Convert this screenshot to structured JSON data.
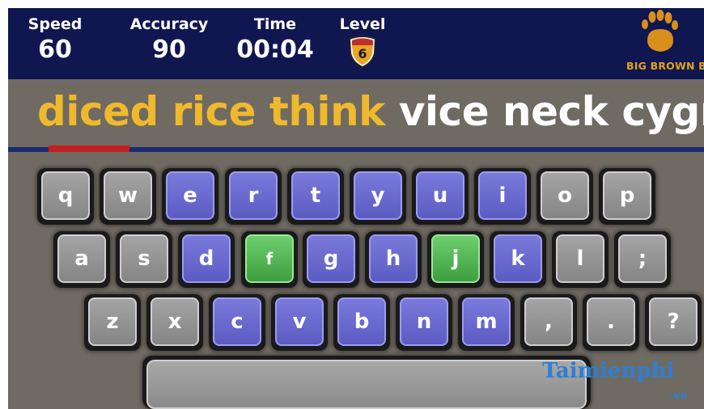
{
  "hud": {
    "speed": {
      "label": "Speed",
      "value": "60"
    },
    "accuracy": {
      "label": "Accuracy",
      "value": "90"
    },
    "time": {
      "label": "Time",
      "value": "00:04"
    },
    "level": {
      "label": "Level",
      "value": "6"
    },
    "logo_text": "BIG BROWN BEA"
  },
  "words": {
    "typed": "diced rice think",
    "pending": " vice neck cygnet"
  },
  "keyboard": {
    "row1": [
      "q",
      "w",
      "e",
      "r",
      "t",
      "y",
      "u",
      "i",
      "o",
      "p"
    ],
    "row2": [
      "a",
      "s",
      "d",
      "f",
      "g",
      "h",
      "j",
      "k",
      "l",
      ";"
    ],
    "row3": [
      "z",
      "x",
      "c",
      "v",
      "b",
      "n",
      "m",
      ",",
      ".",
      "?"
    ]
  },
  "watermark": {
    "main": "Taimienphi",
    "sub": ".vn"
  },
  "colors": {
    "hud_bg": "#0f1650",
    "typed_text": "#f0b92d",
    "pending_text": "#ffffff",
    "key_gray": "#999999",
    "key_purple": "#6a6ad0",
    "key_green": "#52b852",
    "progress": "#c02020"
  }
}
